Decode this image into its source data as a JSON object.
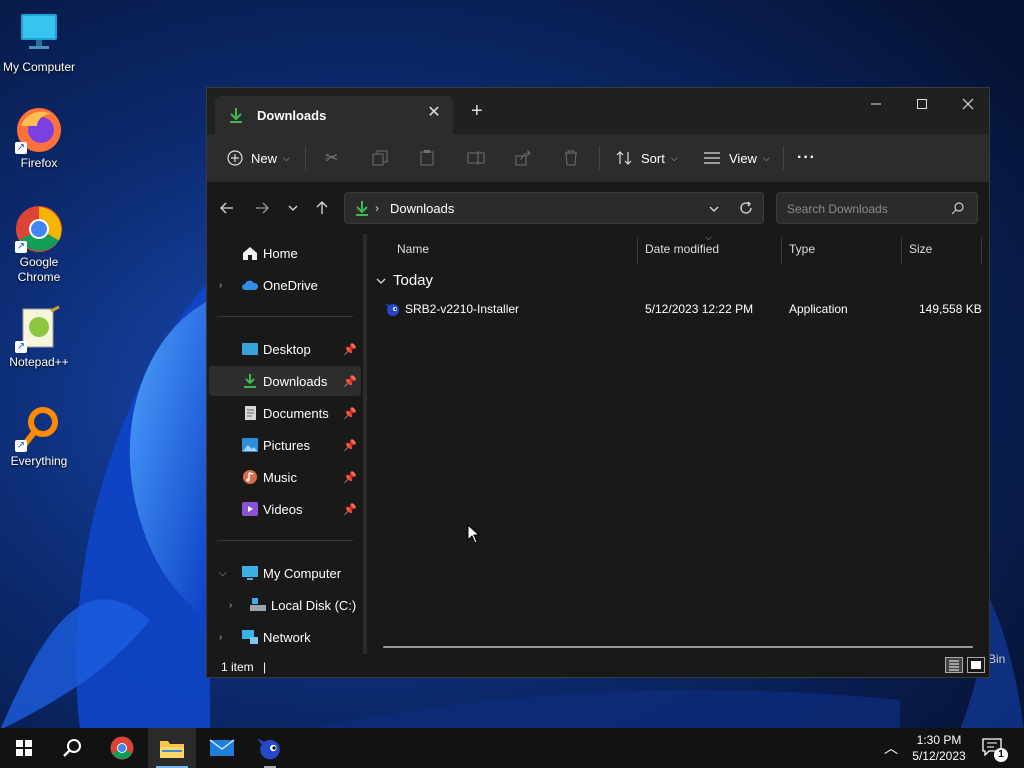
{
  "desktop": {
    "icons": [
      {
        "label": "My Computer"
      },
      {
        "label": "Firefox"
      },
      {
        "label": "Google Chrome"
      },
      {
        "label": "Notepad++"
      },
      {
        "label": "Everything"
      }
    ],
    "recycle_partial": "Bin"
  },
  "explorer": {
    "tab_title": "Downloads",
    "toolbar": {
      "new_label": "New",
      "sort_label": "Sort",
      "view_label": "View",
      "more_label": "···"
    },
    "address": {
      "path": "Downloads",
      "search_placeholder": "Search Downloads"
    },
    "nav": {
      "home": "Home",
      "onedrive": "OneDrive",
      "pinned": [
        "Desktop",
        "Downloads",
        "Documents",
        "Pictures",
        "Music",
        "Videos"
      ],
      "my_computer": "My Computer",
      "local_disk": "Local Disk (C:)",
      "network": "Network"
    },
    "columns": [
      "Name",
      "Date modified",
      "Type",
      "Size"
    ],
    "group": "Today",
    "files": [
      {
        "name": "SRB2-v2210-Installer",
        "date": "5/12/2023 12:22 PM",
        "type": "Application",
        "size": "149,558 KB"
      }
    ],
    "status": {
      "count": "1 item",
      "caret": "|"
    }
  },
  "taskbar": {
    "time": "1:30 PM",
    "date": "5/12/2023",
    "notifications": "1"
  },
  "colors": {
    "accent": "#76b9ed",
    "download_green": "#3fb950",
    "window_bg": "#191919"
  }
}
